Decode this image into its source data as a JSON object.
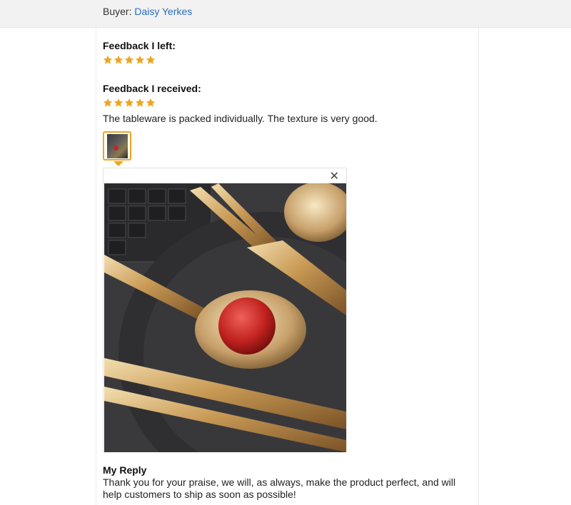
{
  "buyer": {
    "label": "Buyer:",
    "name": "Daisy Yerkes"
  },
  "feedback_left": {
    "heading": "Feedback I left:",
    "rating": 5,
    "max": 5
  },
  "feedback_received": {
    "heading": "Feedback I received:",
    "rating": 5,
    "max": 5,
    "comment": "The tableware is packed individually. The texture is very good."
  },
  "viewer": {
    "close_symbol": "✕"
  },
  "reply": {
    "title": "My Reply",
    "text": "Thank you for your praise, we will, as always, make the product perfect, and will help customers to ship as soon as possible!"
  },
  "colors": {
    "star": "#f0a51c",
    "link": "#2a6ebb",
    "thumb_border": "#f0a51c"
  },
  "icons": {
    "star": "star-icon",
    "close": "close-icon"
  }
}
